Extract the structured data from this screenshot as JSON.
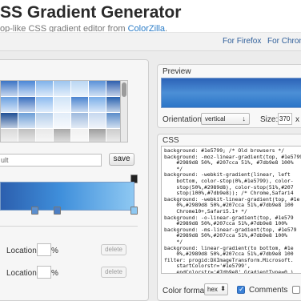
{
  "header": {
    "title": "SS Gradient Generator",
    "subtitle_prefix": "op-like CSS gradient editor from ",
    "subtitle_link": "ColorZilla",
    "subtitle_suffix": "."
  },
  "nav": {
    "firefox": "For Firefox",
    "chrome": "For Chrom"
  },
  "presets": {
    "swatches": [
      "#3b73c4",
      "#4a86d6",
      "#7fb2ea",
      "#9cc4ef",
      "#b9d6f3",
      "#5a92d8",
      "#2f5fae",
      "#6aa0e0",
      "#3a6fbf",
      "#8dbbef",
      "#cfe3f7",
      "#4b84cf",
      "#7aaee8",
      "#2b63b0",
      "#1f4f95",
      "#6c9ed6",
      "#b3cdea",
      "#e1ecf8",
      "#9db9dd",
      "#c7d8ef",
      "#5b8cc9",
      "#d8d8d8",
      "#bfbfbf",
      "#e8e8e8",
      "#a9a9a9",
      "#f0f0f0",
      "#9e9e9e",
      "#cccccc",
      "#7e8a97",
      "#5e6b79",
      "#3f4a57",
      "#8ea25a",
      "#b8a04a",
      "#6b8e3e",
      "#b23a3a",
      "#f1e7a8",
      "#f4ec9c",
      "#eaf2ba",
      "#c9d98a",
      "#e6e08a",
      "#a8c36a",
      "#f5f5c8"
    ],
    "name_value": "ult",
    "save_label": "save"
  },
  "stops": {
    "location_label": "Location:",
    "percent": "%",
    "delete_label": "delete"
  },
  "preview": {
    "title": "Preview",
    "orientation_label": "Orientation:",
    "orientation_value": "vertical",
    "size_label": "Size:",
    "size_value": "370",
    "size_x": "x"
  },
  "css": {
    "title": "CSS",
    "lines": [
      "background: #1e5799; /* Old browsers */",
      "background: -moz-linear-gradient(top, #1e5799",
      "    #2989d8 50%, #207cca 51%, #7db9e8 100%",
      "    */",
      "background: -webkit-gradient(linear, left",
      "    bottom, color-stop(0%,#1e5799), color-",
      "    stop(50%,#2989d8), color-stop(51%,#207",
      "    stop(100%,#7db9e8)); /* Chrome,Safari4",
      "background: -webkit-linear-gradient(top, #1e",
      "    0%,#2989d8 50%,#207cca 51%,#7db9e8 100",
      "    Chrome10+,Safari5.1+ */",
      "background: -o-linear-gradient(top, #1e579",
      "    #2989d8 50%,#207cca 51%,#7db9e8 100%",
      "background: -ms-linear-gradient(top, #1e579",
      "    #2989d8 50%,#207cca 51%,#7db9e8 100%",
      "    */",
      "background: linear-gradient(to bottom, #1e",
      "    0%,#2989d8 50%,#207cca 51%,#7db9e8 100",
      "filter: progid:DXImageTransform.Microsoft.",
      "    startColorstr='#1e5799',",
      "    endColorstr='#7db9e8',GradientType=0 )"
    ],
    "format_label": "Color format:",
    "format_value": "hex",
    "comments_label": "Comments"
  }
}
